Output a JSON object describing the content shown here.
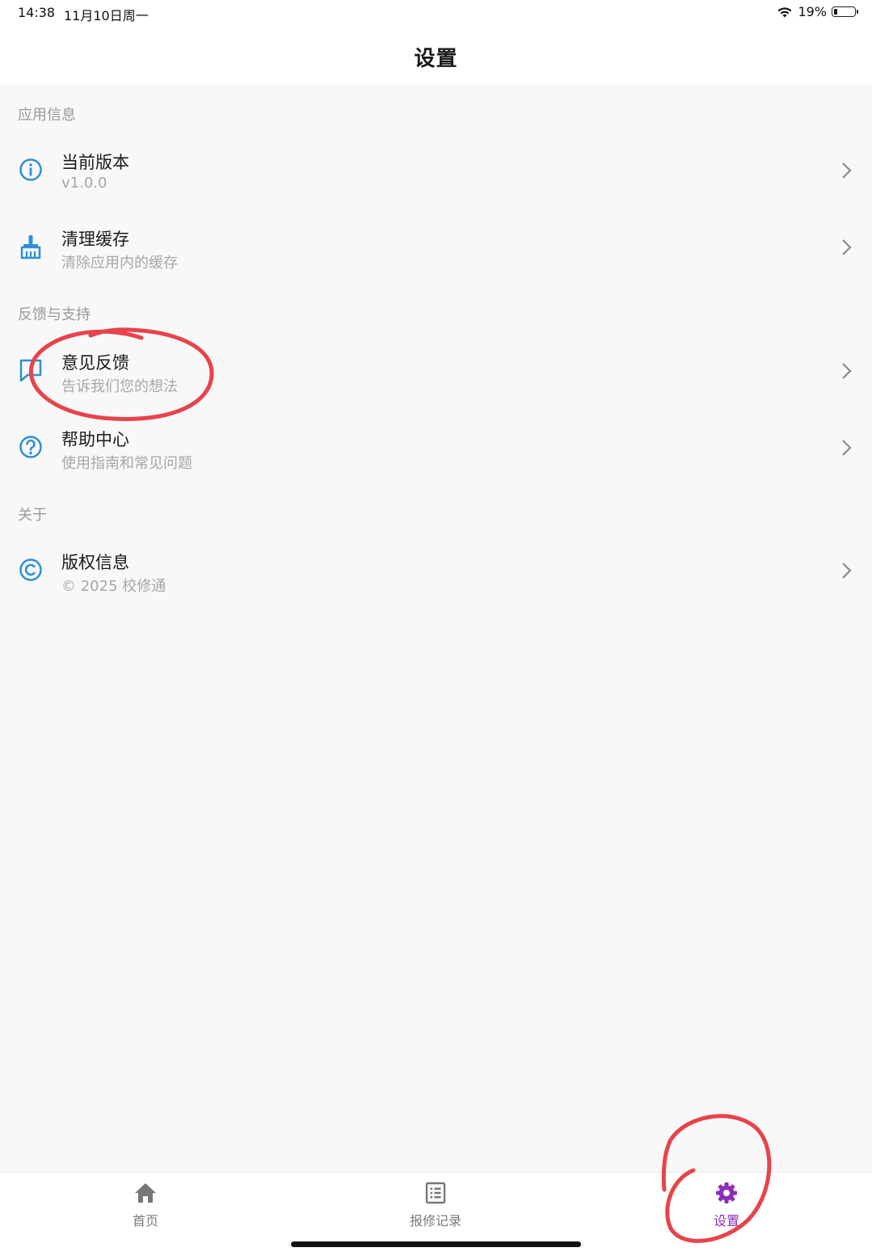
{
  "status_bar": {
    "time": "14:38",
    "date": "11月10日周一",
    "battery_percent": "19%",
    "battery_level": 0.19
  },
  "header": {
    "title": "设置"
  },
  "sections": [
    {
      "title": "应用信息",
      "items": [
        {
          "title": "当前版本",
          "subtitle": "v1.0.0",
          "icon": "info-icon"
        },
        {
          "title": "清理缓存",
          "subtitle": "清除应用内的缓存",
          "icon": "broom-icon"
        }
      ]
    },
    {
      "title": "反馈与支持",
      "items": [
        {
          "title": "意见反馈",
          "subtitle": "告诉我们您的想法",
          "icon": "feedback-icon"
        },
        {
          "title": "帮助中心",
          "subtitle": "使用指南和常见问题",
          "icon": "help-icon"
        }
      ]
    },
    {
      "title": "关于",
      "items": [
        {
          "title": "版权信息",
          "subtitle": "© 2025 校修通",
          "icon": "copyright-icon"
        }
      ]
    }
  ],
  "tabbar": {
    "tabs": [
      {
        "label": "首页",
        "icon": "home-icon",
        "active": false
      },
      {
        "label": "报修记录",
        "icon": "list-icon",
        "active": false
      },
      {
        "label": "设置",
        "icon": "gear-icon",
        "active": true
      }
    ]
  },
  "colors": {
    "icon_blue": "#2f8fd8",
    "active_tab": "#8e2db8",
    "annotation_red": "#e8434b"
  }
}
